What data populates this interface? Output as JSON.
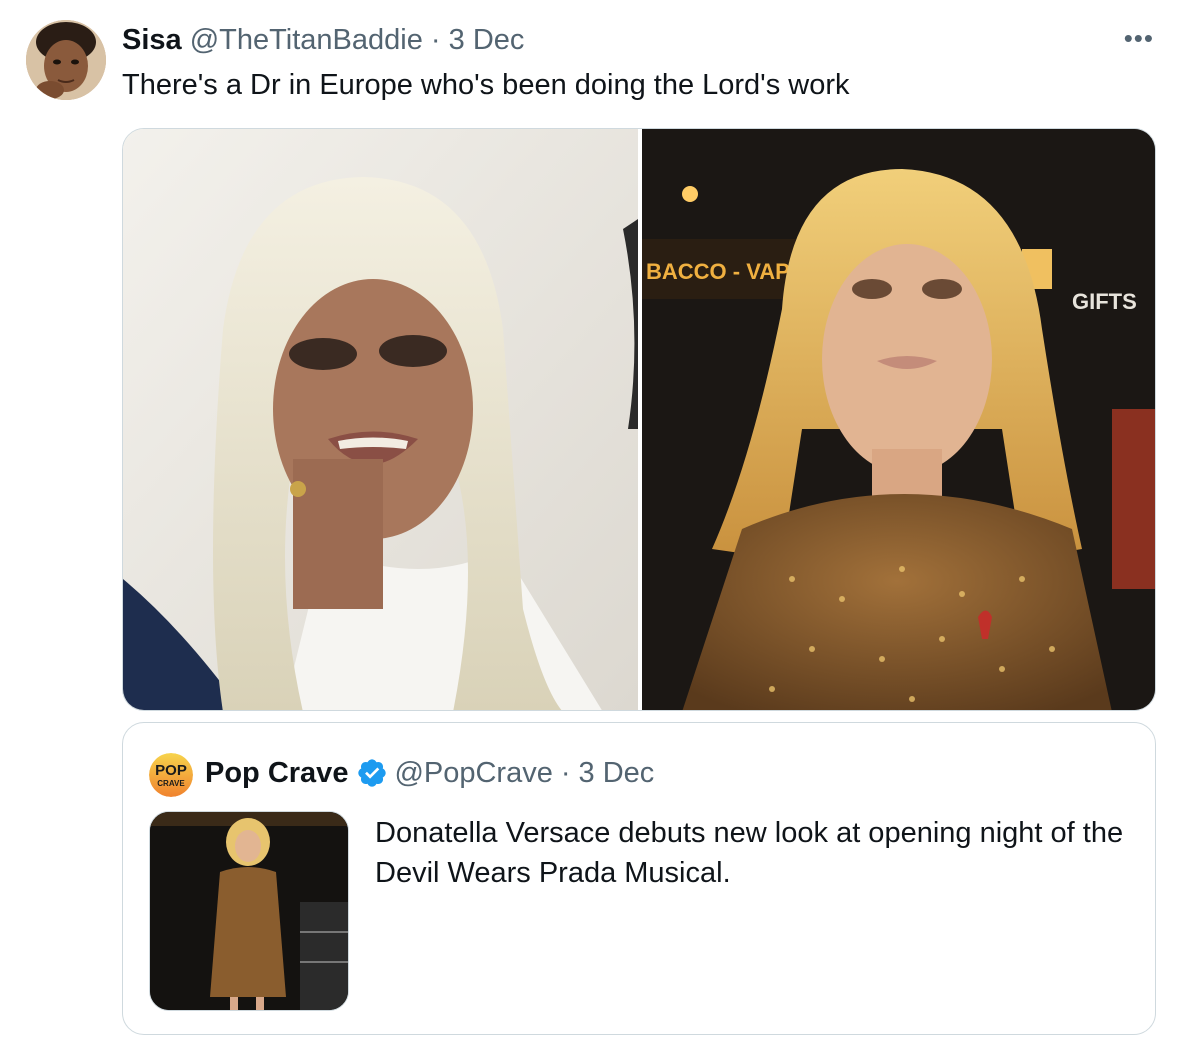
{
  "tweet": {
    "author_name": "Sisa",
    "handle": "@TheTitanBaddie",
    "separator": "·",
    "date": "3 Dec",
    "text": "There's a Dr in Europe who's been doing the Lord's work",
    "more_icon": "more-horizontal-icon",
    "media": {
      "photo_right_sign_left": "BACCO - VAPE",
      "photo_right_sign_right": "GIFTS"
    }
  },
  "quote": {
    "author_name": "Pop Crave",
    "handle": "@PopCrave",
    "separator": "·",
    "date": "3 Dec",
    "verified_icon": "verified-badge-icon",
    "logo_top": "POP",
    "logo_bottom": "CRAVE",
    "text": "Donatella Versace debuts new look at opening night of the Devil Wears Prada Musical."
  },
  "colors": {
    "text_primary": "#0f1419",
    "text_muted": "#536471",
    "border": "#cfd9de",
    "verified_blue": "#1d9bf0"
  }
}
